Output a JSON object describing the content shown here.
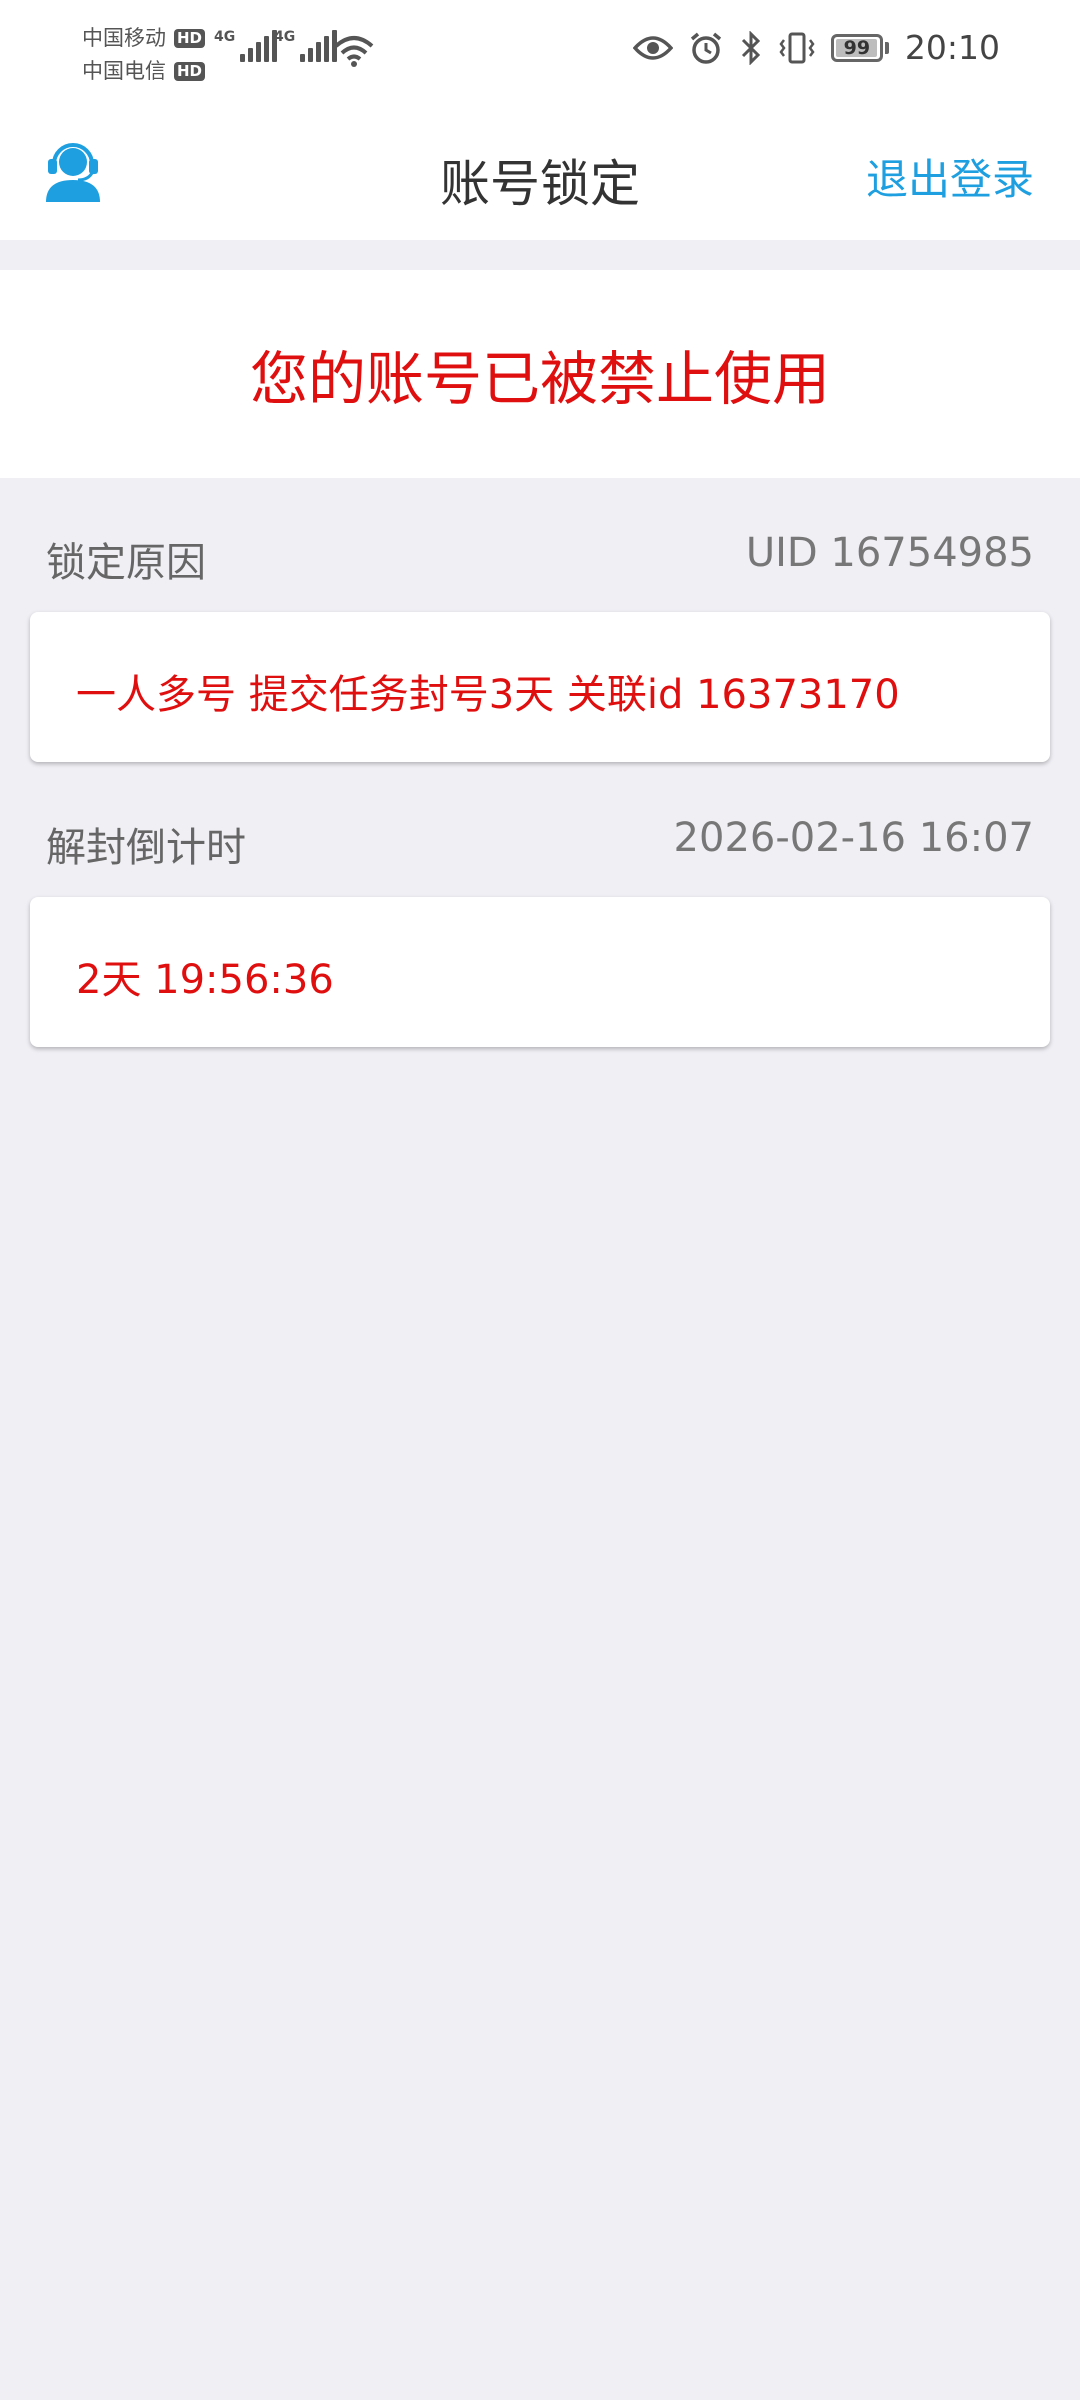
{
  "status_bar": {
    "carrier_1": "中国移动",
    "carrier_2": "中国电信",
    "hd_badge": "HD",
    "network_1": "4G",
    "network_2": "4G",
    "battery_level": "99",
    "time": "20:10"
  },
  "header": {
    "title": "账号锁定",
    "logout_label": "退出登录",
    "support_icon": "customer-service-icon",
    "accent_color": "#1e9fe0"
  },
  "banner": {
    "message": "您的账号已被禁止使用",
    "color": "#e00f0f"
  },
  "lock_reason": {
    "label": "锁定原因",
    "uid": "UID 16754985",
    "reason": "一人多号 提交任务封号3天 关联id 16373170"
  },
  "unlock_countdown": {
    "label": "解封倒计时",
    "unlock_time": "2026-02-16 16:07",
    "remaining": "2天 19:56:36"
  }
}
